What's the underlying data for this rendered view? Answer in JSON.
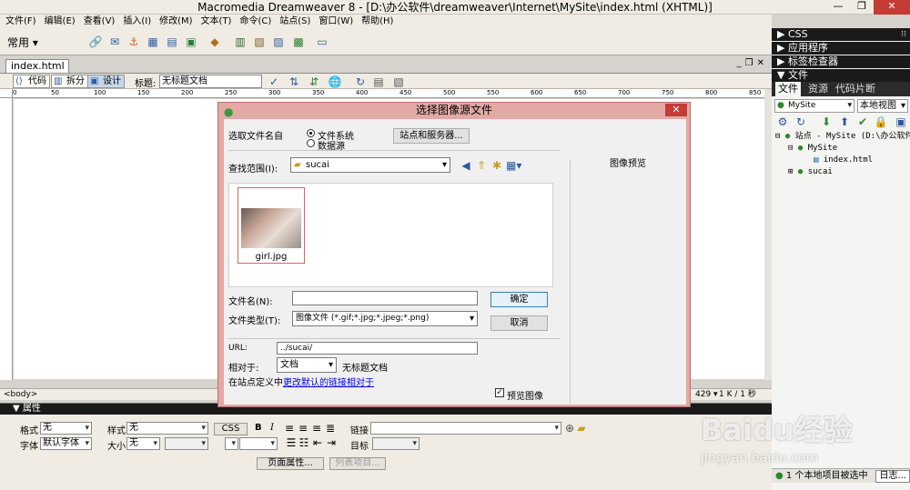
{
  "window": {
    "title": "Macromedia Dreamweaver 8 - [D:\\办公软件\\dreamweaver\\Internet\\MySite\\index.html (XHTML)]"
  },
  "menu": [
    "文件(F)",
    "编辑(E)",
    "查看(V)",
    "插入(I)",
    "修改(M)",
    "文本(T)",
    "命令(C)",
    "站点(S)",
    "窗口(W)",
    "帮助(H)"
  ],
  "insert_bar": {
    "category": "常用"
  },
  "document": {
    "tab": "index.html",
    "views": {
      "code": "代码",
      "split": "拆分",
      "design": "设计"
    },
    "title_label": "标题:",
    "title_value": "无标题文档",
    "ruler_ticks": [
      "0",
      "50",
      "100",
      "150",
      "200",
      "250",
      "300",
      "350",
      "400",
      "450",
      "500",
      "550",
      "600",
      "650",
      "700",
      "750",
      "800",
      "850"
    ],
    "status_tag": "<body>",
    "status_size": "429 ▾",
    "status_kb": "1 K / 1 秒"
  },
  "panels": {
    "css": "CSS",
    "app": "应用程序",
    "tag_inspector": "标签检查器",
    "files": "文件",
    "files_tabs": [
      "文件",
      "资源",
      "代码片断"
    ],
    "site_select": "MySite",
    "view_select": "本地视图",
    "tree": [
      "站点 - MySite (D:\\办公软件",
      "MySite",
      "index.html",
      "sucai"
    ],
    "status": "1 个本地项目被选中",
    "log": "日志..."
  },
  "properties": {
    "header": "属性",
    "format_label": "格式",
    "format_value": "无",
    "style_label": "样式",
    "style_value": "无",
    "css_btn": "CSS",
    "bold": "B",
    "italic": "I",
    "link_label": "链接",
    "font_label": "字体",
    "font_value": "默认字体",
    "size_label": "大小",
    "size_value": "无",
    "target_label": "目标",
    "page_props": "页面属性...",
    "list_item": "列表项目..."
  },
  "dialog": {
    "title": "选择图像源文件",
    "select_from": "选取文件名自",
    "radio_fs": "文件系统",
    "radio_ds": "数据源",
    "sites_btn": "站点和服务器...",
    "look_in_label": "查找范围(I):",
    "look_in_value": "sucai",
    "file_name": "girl.jpg",
    "preview_label": "图像预览",
    "filename_label": "文件名(N):",
    "filetype_label": "文件类型(T):",
    "filetype_value": "图像文件 (*.gif;*.jpg;*.jpeg;*.png)",
    "ok": "确定",
    "cancel": "取消",
    "url_label": "URL:",
    "url_value": "../sucai/",
    "relative_label": "相对于:",
    "relative_value": "文档",
    "relative_doc": "无标题文档",
    "site_def_text": "在站点定义中",
    "site_def_link": "更改默认的链接相对于",
    "preview_check": "预览图像"
  },
  "watermark": {
    "logo": "Baidu经验",
    "url": "jingyan.baidu.com"
  }
}
